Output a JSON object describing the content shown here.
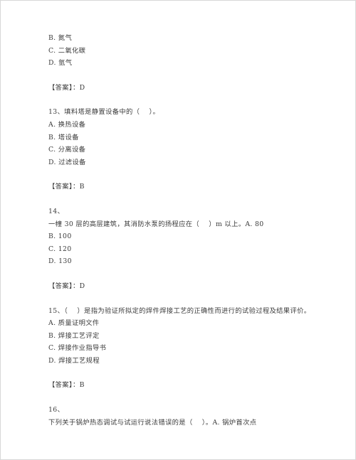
{
  "document": {
    "type": "exam-question-sheet",
    "language": "zh-CN",
    "answer_prefix_a": "【答案】：",
    "answer_prefix_b": "【答案】 ：",
    "page_background": "#ffffff",
    "text_color": "#3b3b3b",
    "border_color": "#d8d8d8"
  },
  "blocks": {
    "q12_tail": {
      "options": [
        "B. 氮气",
        "C. 二氧化碳",
        "D. 氩气"
      ],
      "answer_line": "【答案】：D"
    },
    "q13": {
      "stem": "13、填料塔是静置设备中的（    ）。",
      "options": [
        "A. 换热设备",
        "B. 塔设备",
        "C. 分离设备",
        "D. 过滤设备"
      ],
      "answer_line": "【答案】：B"
    },
    "q14": {
      "number_line": "14、",
      "stem": "一幢 30 层的高层建筑，其消防水泵的扬程应在（    ）m 以上。A. 80",
      "options": [
        "B. 100",
        "C. 120",
        "D. 130"
      ],
      "answer_line": "【答案】：D"
    },
    "q15": {
      "stem": "15、（    ）是指为验证所拟定的焊件焊接工艺的正确性而进行的试验过程及结果评价。",
      "options": [
        "A. 质量证明文件",
        "B. 焊接工艺评定",
        "C. 焊接作业指导书",
        "D. 焊接工艺规程"
      ],
      "answer_line": "【答案】：B"
    },
    "q16": {
      "number_line": "16、",
      "stem": "下列关于锅炉热态调试与试运行说法错误的是（    ）。A. 锅炉首次点"
    }
  }
}
